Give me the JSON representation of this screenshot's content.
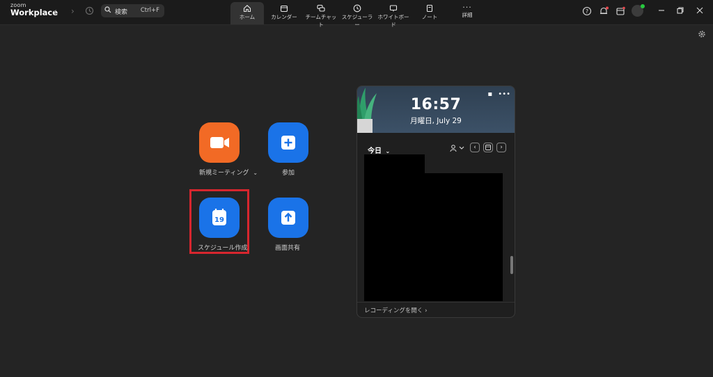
{
  "app": {
    "logo_small": "zoom",
    "logo_big": "Workplace"
  },
  "search": {
    "label": "検索",
    "shortcut": "Ctrl+F"
  },
  "tabs": [
    {
      "label": "ホーム",
      "icon": "home-icon",
      "active": true
    },
    {
      "label": "カレンダー",
      "icon": "calendar-icon"
    },
    {
      "label": "チームチャット",
      "icon": "chat-icon"
    },
    {
      "label": "スケジューラー",
      "icon": "clock-icon"
    },
    {
      "label": "ホワイトボード",
      "icon": "whiteboard-icon"
    },
    {
      "label": "ノート",
      "icon": "note-icon"
    },
    {
      "label": "詳細",
      "icon": "more-icon"
    }
  ],
  "actions": {
    "new_meeting": "新規ミーティング",
    "new_meeting_chevron": "⌄",
    "join": "参加",
    "schedule": "スケジュール作成",
    "schedule_day": "19",
    "share_screen": "画面共有"
  },
  "widget": {
    "time": "16:57",
    "date": "月曜日, July 29",
    "today_label": "今日",
    "footer": "レコーディングを開く ›",
    "more_dots": "•••"
  },
  "colors": {
    "orange": "#f26a25",
    "blue": "#1a73e8",
    "highlight": "#d7262e"
  }
}
